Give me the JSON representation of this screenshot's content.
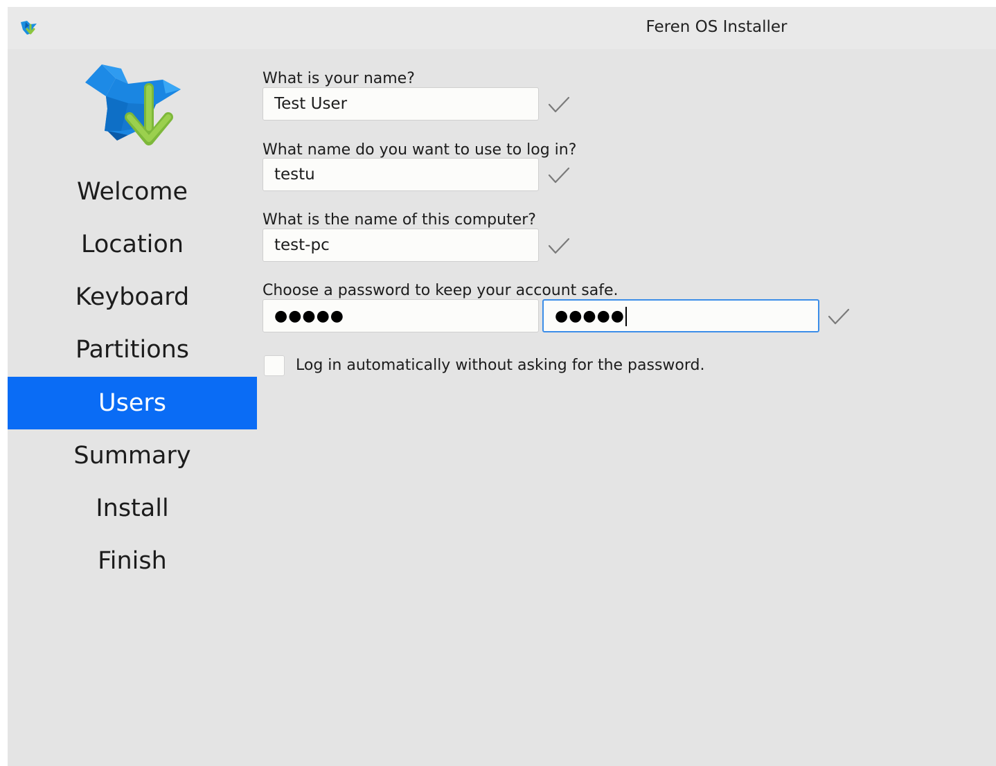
{
  "window": {
    "title": "Feren OS Installer"
  },
  "sidebar": {
    "items": [
      {
        "label": "Welcome",
        "active": false
      },
      {
        "label": "Location",
        "active": false
      },
      {
        "label": "Keyboard",
        "active": false
      },
      {
        "label": "Partitions",
        "active": false
      },
      {
        "label": "Users",
        "active": true
      },
      {
        "label": "Summary",
        "active": false
      },
      {
        "label": "Install",
        "active": false
      },
      {
        "label": "Finish",
        "active": false
      }
    ]
  },
  "form": {
    "name_label": "What is your name?",
    "name_value": "Test User",
    "login_label": "What name do you want to use to log in?",
    "login_value": "testu",
    "computer_label": "What is the name of this computer?",
    "computer_value": "test-pc",
    "password_label": "Choose a password to keep your account safe.",
    "password_value": "●●●●●",
    "password_confirm_value": "●●●●●",
    "autologin_label": "Log in automatically without asking for the password.",
    "autologin_checked": false
  },
  "colors": {
    "accent": "#0a6cf5",
    "background": "#e4e4e4",
    "focus_border": "#3b8de8",
    "valid_check": "#7a7a7a"
  },
  "icons": {
    "app": "feren-bird-icon",
    "logo": "installer-bird-download-icon",
    "valid": "check-icon"
  }
}
